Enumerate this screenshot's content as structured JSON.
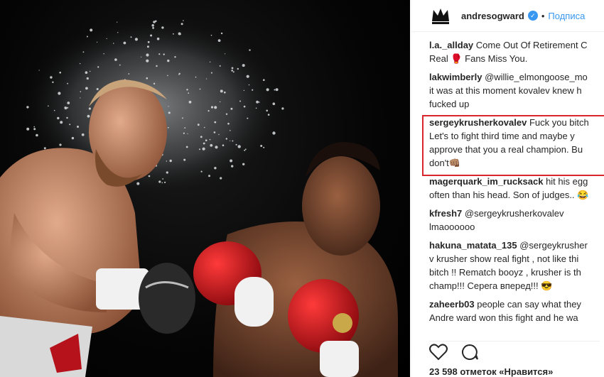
{
  "post": {
    "username": "andresogward",
    "follow_label": "Подписа"
  },
  "comments": [
    {
      "user": "l.a._allday",
      "text": "Come Out Of Retirement C\nReal 🥊 Fans Miss You."
    },
    {
      "user": "lakwimberly",
      "text": "@willie_elmongoose_mo\nit was at this moment kovalev knew h\nfucked up"
    },
    {
      "user": "sergeykrusherkovalev",
      "text": "Fuck you bitch\nLet's to fight third time and maybe y\napprove that you a real champion. Bu\ndon't👊🏽"
    },
    {
      "user": "magerquark_im_rucksack",
      "text": "hit his egg\noften than his head. Son of judges.. 😂"
    },
    {
      "user": "kfresh7",
      "text": "@sergeykrusherkovalev\nlmaoooooo"
    },
    {
      "user": "hakuna_matata_135",
      "text": "@sergeykrusher\nv krusher show real fight , not like thi\nbitch !! Rematch booyz , krusher is th\nchamp!!! Серега вперед!!! 😎"
    },
    {
      "user": "zaheerb03",
      "text": "people can say what they\nAndre ward won this fight and he wa"
    }
  ],
  "likes": "23 598 отметок «Нравится»",
  "icons": {
    "like": "heart-icon",
    "comment": "comment-icon",
    "logo": "crown-logo-icon",
    "verified": "verified-badge-icon"
  },
  "colors": {
    "highlight_border": "#d8262c",
    "link_blue": "#3897f0",
    "glove_red": "#c8141c"
  }
}
